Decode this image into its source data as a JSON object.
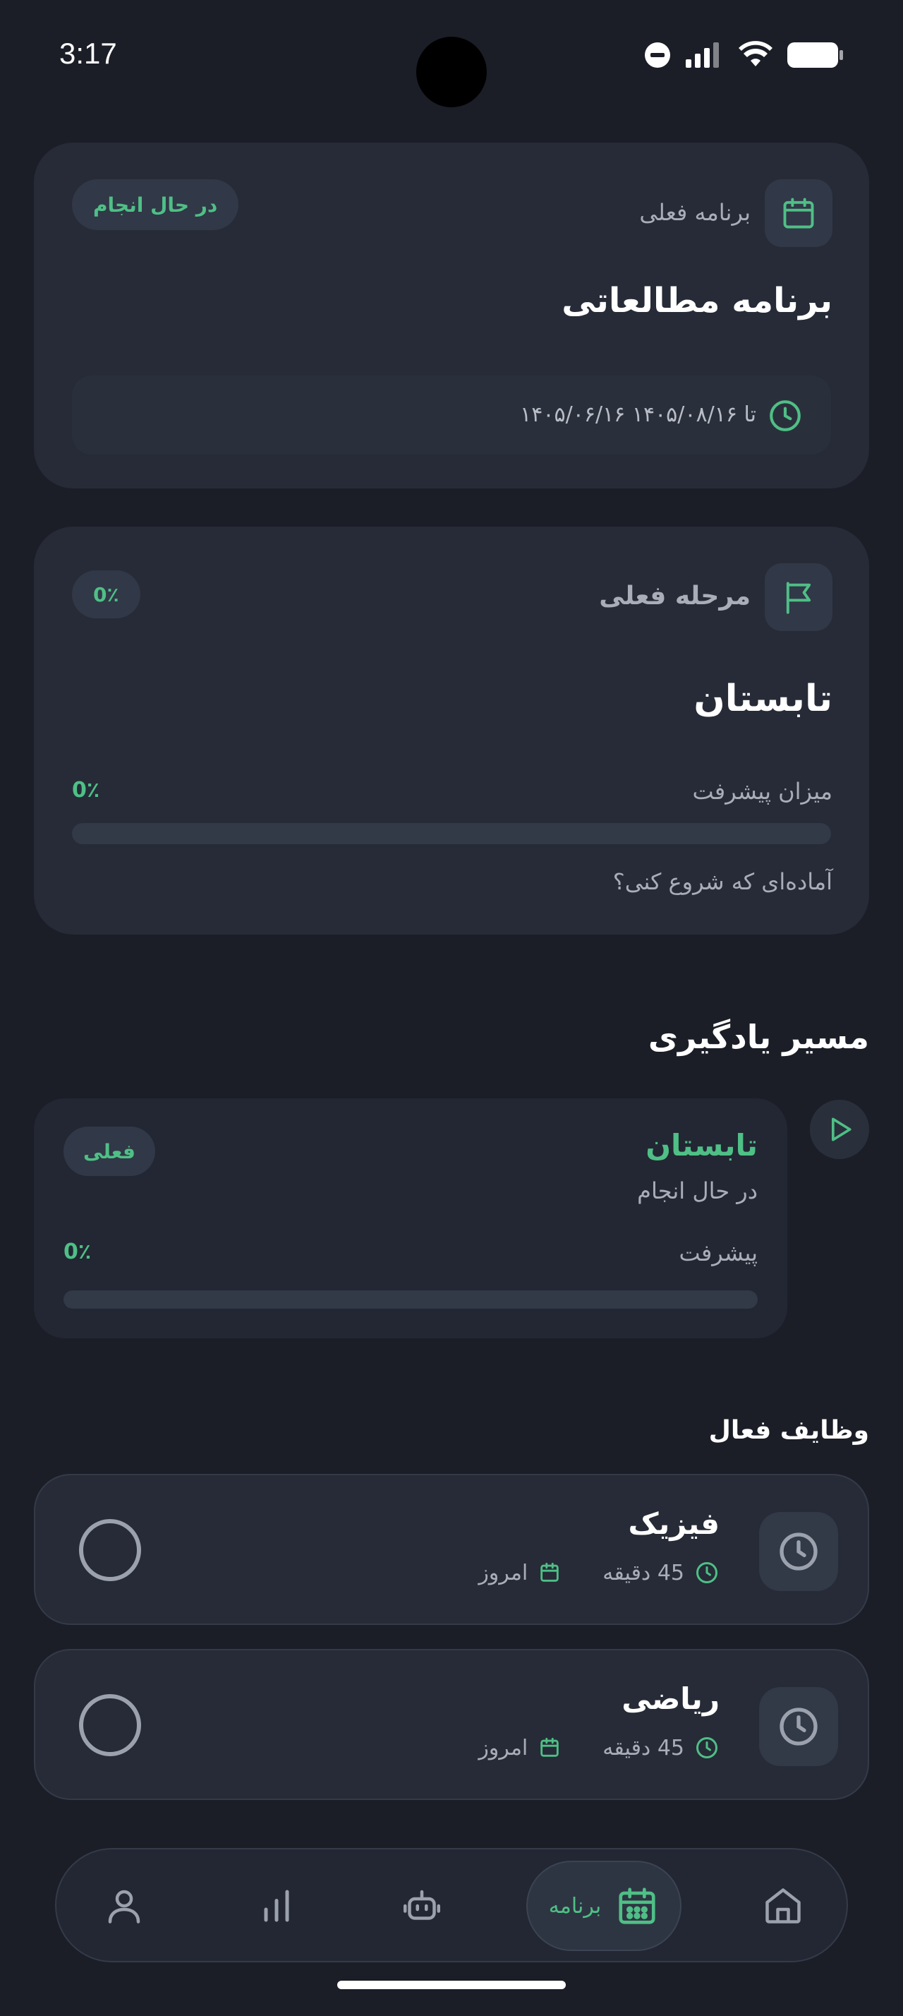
{
  "status": {
    "time": "3:17"
  },
  "current_program": {
    "label": "برنامه فعلی",
    "badge": "در حال انجام",
    "title": "برنامه مطالعاتی",
    "date_range": "۱۴۰۵/۰۶/۱۶ تا ۱۴۰۵/۰۸/۱۶",
    "icon": "calendar-icon"
  },
  "current_stage": {
    "label": "مرحله فعلی",
    "badge": "0٪",
    "title": "تابستان",
    "progress_label": "میزان پیشرفت",
    "progress_value": "0٪",
    "progress_fraction": 0,
    "prompt": "آماده‌ای که شروع کنی؟",
    "icon": "flag-icon"
  },
  "learning_path": {
    "title": "مسیر یادگیری",
    "item": {
      "name": "تابستان",
      "status": "در حال انجام",
      "badge": "فعلی",
      "progress_label": "پیشرفت",
      "progress_value": "0٪",
      "progress_fraction": 0
    }
  },
  "active_tasks": {
    "title": "وظایف فعال",
    "items": [
      {
        "title": "فیزیک",
        "duration": "45 دقیقه",
        "when": "امروز"
      },
      {
        "title": "ریاضی",
        "duration": "45 دقیقه",
        "when": "امروز"
      }
    ]
  },
  "nav": {
    "active_label": "برنامه",
    "items": [
      "home-icon",
      "calendar-icon",
      "robot-icon",
      "chart-icon",
      "profile-icon"
    ]
  },
  "colors": {
    "accent": "#4fbf86",
    "background": "#1b1e27",
    "card": "#262b37"
  }
}
